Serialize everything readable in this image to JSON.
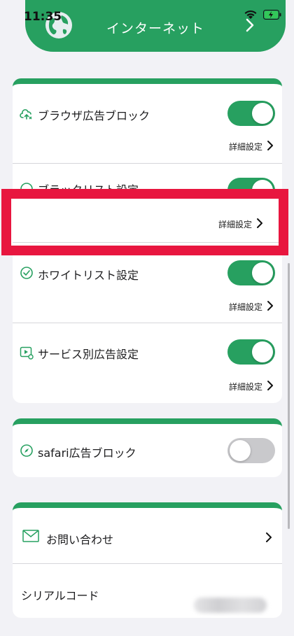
{
  "status_bar": {
    "time": "11:35"
  },
  "header": {
    "title": "インターネット"
  },
  "card1": {
    "rows": [
      {
        "label": "ブラウザ広告ブロック",
        "detail": "詳細設定",
        "toggle": "on"
      },
      {
        "label": "ブラックリスト設定",
        "detail": "詳細設定",
        "toggle": "on"
      },
      {
        "label": "ホワイトリスト設定",
        "detail": "詳細設定",
        "toggle": "on"
      },
      {
        "label": "サービス別広告設定",
        "detail": "詳細設定",
        "toggle": "on"
      }
    ]
  },
  "card2": {
    "label": "safari広告ブロック",
    "toggle": "off"
  },
  "card3": {
    "contact_label": "お問い合わせ",
    "serial_label": "シリアルコード"
  },
  "colors": {
    "accent": "#27a060",
    "highlight": "#e8163f"
  }
}
